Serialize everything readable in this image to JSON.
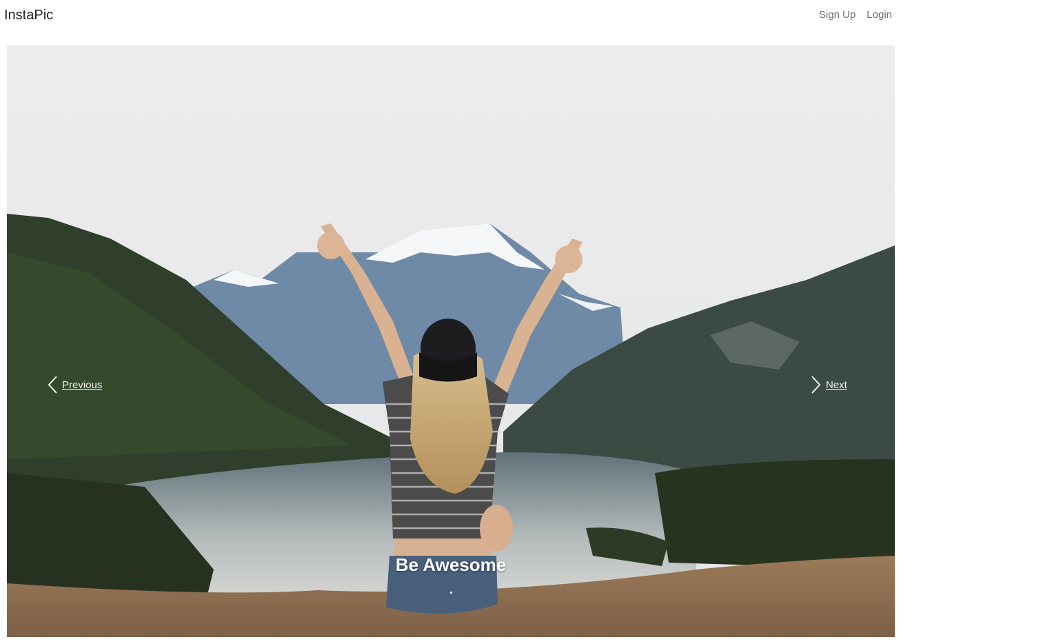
{
  "navbar": {
    "brand": "InstaPic",
    "links": [
      {
        "label": "Sign Up"
      },
      {
        "label": "Login"
      }
    ]
  },
  "carousel": {
    "caption": "Be Awesome",
    "prev_label": "Previous",
    "next_label": "Next",
    "image": {
      "alt": "Woman in cap with arms raised overlooking a mountain lake"
    }
  },
  "colors": {
    "text_dark": "#222222",
    "nav_link": "#6c6c6c",
    "caption": "#ffffff"
  },
  "icons": {
    "prev": "chevron-left-icon",
    "next": "chevron-right-icon"
  }
}
